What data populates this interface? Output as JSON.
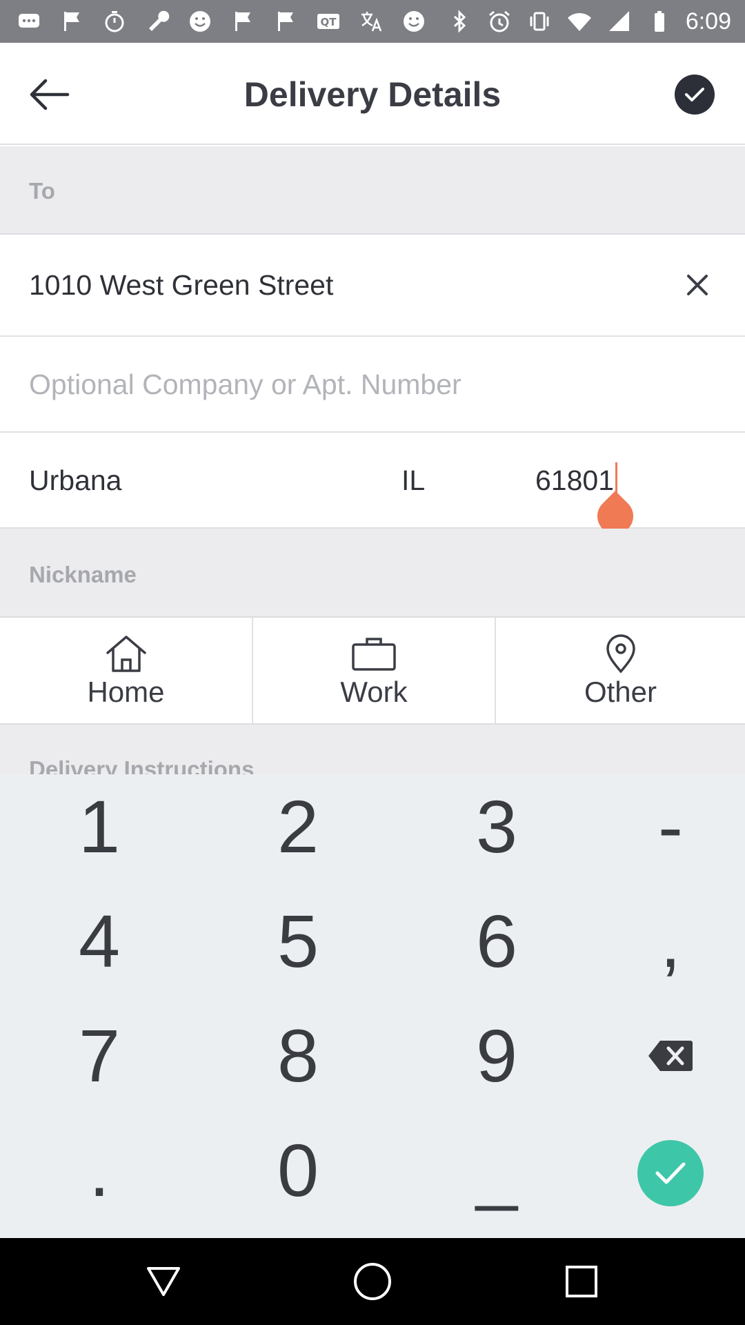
{
  "status_bar": {
    "time": "6:09",
    "left_icons": [
      "messages-icon",
      "flag-icon",
      "timer-icon",
      "wrench-icon",
      "smiley-icon",
      "flag-icon",
      "flag-icon",
      "qt-icon",
      "translate-icon",
      "smiley-icon"
    ],
    "right_icons": [
      "bluetooth-icon",
      "alarm-icon",
      "vibrate-icon",
      "wifi-icon",
      "signal-icon",
      "battery-icon"
    ]
  },
  "header": {
    "title": "Delivery Details"
  },
  "sections": {
    "to_label": "To",
    "nickname_label": "Nickname",
    "instructions_label": "Delivery Instructions"
  },
  "address": {
    "street": "1010 West Green Street",
    "apt_placeholder": "Optional Company or Apt. Number",
    "city": "Urbana",
    "state": "IL",
    "zip": "61801"
  },
  "nickname_options": [
    {
      "label": "Home",
      "icon": "home-icon"
    },
    {
      "label": "Work",
      "icon": "briefcase-icon"
    },
    {
      "label": "Other",
      "icon": "location-pin-icon"
    }
  ],
  "keyboard": {
    "rows": [
      [
        "1",
        "2",
        "3",
        "-"
      ],
      [
        "4",
        "5",
        "6",
        ","
      ],
      [
        "7",
        "8",
        "9"
      ],
      [
        ".",
        "0",
        "_"
      ]
    ]
  },
  "colors": {
    "accent_orange": "#f07a54",
    "enter_green": "#3ec6a8",
    "header_dark": "#2c2f38"
  }
}
